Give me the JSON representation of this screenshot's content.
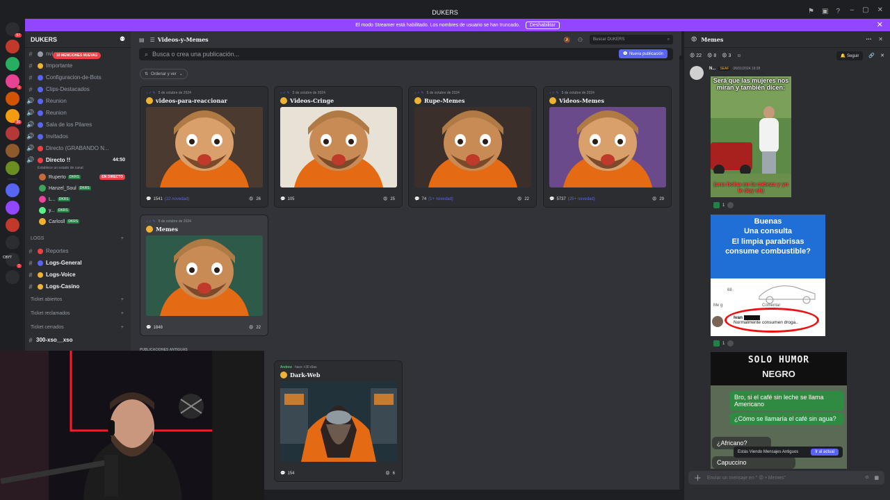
{
  "app": {
    "title": "DUKERS"
  },
  "streamer_banner": {
    "text": "El modo Streamer está habilitado. Los nombres de usuario se han truncado.",
    "button": "Deshabilitar"
  },
  "guild_rail": {
    "badges": [
      "57",
      "1",
      "30",
      "1"
    ],
    "server_label": "CBYT",
    "icon_colors": [
      "#2b2d31",
      "#c0392b",
      "#27ae60",
      "#e84393",
      "#d35400",
      "#f39c12",
      "#b33939",
      "#8e5a2b",
      "#6b8e23",
      "#2b2d31",
      "#5865f2",
      "#9146ff",
      "#c0392b",
      "#2b2d31",
      "#2b2d31",
      "#2b2d31"
    ]
  },
  "server": {
    "name": "DUKERS",
    "mentions_badge": "10 MENCIONES NUEVAS"
  },
  "channels": [
    {
      "icon": "#",
      "name": "nviar",
      "color": "#949ba4",
      "bold": false
    },
    {
      "icon": "#",
      "name": "Importante",
      "color": "#f0b232",
      "bold": false
    },
    {
      "icon": "#",
      "name": "Configuracion-de-Bots",
      "color": "#5865f2",
      "bold": false
    },
    {
      "icon": "#",
      "name": "Clips-Destacados",
      "color": "#5865f2",
      "bold": false
    },
    {
      "icon": "🔊",
      "name": "Reunion",
      "color": "#5865f2",
      "bold": false
    },
    {
      "icon": "🔊",
      "name": "Reunion",
      "color": "#5865f2",
      "bold": false
    },
    {
      "icon": "🔊",
      "name": "Sala de los Pilares",
      "color": "#5865f2",
      "bold": false
    },
    {
      "icon": "🔊",
      "name": "Invitados",
      "color": "#5865f2",
      "bold": false
    },
    {
      "icon": "🔊",
      "name": "Directo (GRABANDO N...",
      "color": "#f23f43",
      "bold": false
    }
  ],
  "live_channel": {
    "name": "Directo !!",
    "time": "44:50",
    "status": "Establece un estado de canal"
  },
  "voice_users": [
    {
      "name": "Ruperto",
      "tag": "DKRS",
      "live": "EN DIRECTO",
      "color": "#c56a3a"
    },
    {
      "name": "Hanzel_Soul",
      "tag": "DKRS",
      "live": "",
      "color": "#3ba55c"
    },
    {
      "name": "L...",
      "tag": "DKRS",
      "live": "",
      "color": "#eb459e"
    },
    {
      "name": "y...",
      "tag": "DKRS",
      "live": "",
      "color": "#57f287"
    },
    {
      "name": "Carlosll",
      "tag": "DKRS",
      "live": "",
      "color": "#f0b232"
    }
  ],
  "logs_category": "LOGS",
  "log_channels": [
    {
      "name": "Reportes",
      "bold": false
    },
    {
      "name": "Logs-General",
      "bold": true
    },
    {
      "name": "Logs-Voice",
      "bold": true
    },
    {
      "name": "Logs-Casino",
      "bold": true
    }
  ],
  "ticket_categories": [
    "Ticket abiertos",
    "Ticket reclamados",
    "Ticket cerrados"
  ],
  "extra_channel": "300-xso__xso",
  "forum": {
    "channel": "Videos-y-Memes",
    "search_placeholder": "Busca o crea una publicación...",
    "new_post": "Nueva publicación",
    "sort": "Ordenar y ver",
    "top_search": "Buscar DUKERS",
    "old_label": "PUBLICACIONES ANTIGUAS",
    "cards": [
      {
        "date": "5 de octubre de 2024",
        "title": "videos-para-reaccionar",
        "count": "1541",
        "new": "(22 novedad)",
        "reacts": "26",
        "selected": false
      },
      {
        "date": "5 de octubre de 2024",
        "title": "Videos-Cringe",
        "count": "105",
        "new": "",
        "reacts": "25",
        "selected": false
      },
      {
        "date": "5 de octubre de 2024",
        "title": "Rupe-Memes",
        "count": "74",
        "new": "(1+ novedad)",
        "reacts": "22",
        "selected": false
      },
      {
        "date": "5 de octubre de 2024",
        "title": "Videos-Memes",
        "count": "5737",
        "new": "(25+ novedad)",
        "reacts": "29",
        "selected": false
      },
      {
        "date": "5 de octubre de 2024",
        "title": "Memes",
        "count": "1848",
        "new": "",
        "reacts": "22",
        "selected": true
      }
    ],
    "old_card": {
      "author": "Andrew",
      "date": "hace >30 días",
      "title": "Dark-Web",
      "count": "154",
      "reacts": "6"
    }
  },
  "thread": {
    "title": "Memes",
    "reactions": [
      "22",
      "8",
      "3"
    ],
    "follow": "Seguir",
    "post": {
      "author": "N...",
      "tag": "SEAF",
      "date": "06/01/2024 19:28"
    },
    "meme1": {
      "top": "Será que las mujeres nos miran y también dicen:",
      "bottom": "(una bolsa en la cabeza y yo le doy eh)"
    },
    "meme1_reacts": "1",
    "meme2": {
      "lines": [
        "Buenas",
        "Una consulta",
        "El limpia parabrisas",
        "consume combustible?"
      ],
      "reply_name": "Ivan",
      "reply": "Normalmente consumen droga..",
      "count": "68",
      "comment": "Comentar",
      "like": "Me g"
    },
    "meme2_reacts": "1",
    "meme3": {
      "header1": "SOLO HUMOR",
      "header2": "NEGRO",
      "b1": "Bro, si el café sin leche se llama Americano",
      "b2": "¿Cómo se llamaría el café sin agua?",
      "b3": "¿Africano?",
      "b4": "Capuccino"
    },
    "toast": {
      "text": "Estás Viendo Mensajes Antiguos",
      "button": "Ir al actual"
    },
    "composer_placeholder": "Enviar un mensaje en \" 😡 • Memes\""
  }
}
